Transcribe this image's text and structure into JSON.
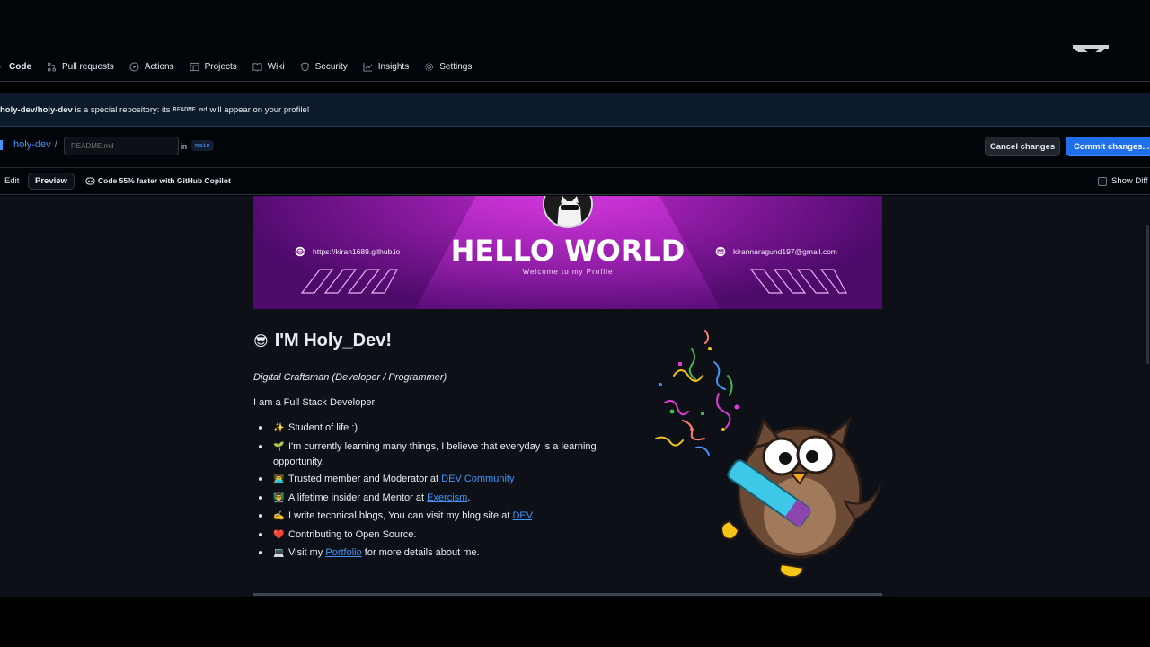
{
  "nav": {
    "items": [
      {
        "label": "Code",
        "icon": "chevron-icon"
      },
      {
        "label": "Pull requests",
        "icon": "pull-request-icon"
      },
      {
        "label": "Actions",
        "icon": "play-circle-icon"
      },
      {
        "label": "Projects",
        "icon": "table-icon"
      },
      {
        "label": "Wiki",
        "icon": "book-icon"
      },
      {
        "label": "Security",
        "icon": "shield-icon"
      },
      {
        "label": "Insights",
        "icon": "graph-icon"
      },
      {
        "label": "Settings",
        "icon": "gear-icon"
      }
    ]
  },
  "notice": {
    "repo": "holy-dev/holy-dev",
    "text1": "is a special repository: its",
    "file": "README.md",
    "text2": "will appear on your profile!"
  },
  "editor": {
    "repo_link": "holy-dev",
    "slash": "/",
    "filename_placeholder": "README.md",
    "in_label": "in",
    "branch": "main",
    "cancel_label": "Cancel changes",
    "commit_label": "Commit changes..."
  },
  "tabs": {
    "edit": "Edit",
    "preview": "Preview",
    "copilot": "Code 55% faster with GitHub Copilot",
    "show_diff": "Show Diff"
  },
  "banner": {
    "title": "HELLO WORLD",
    "subtitle": "Welcome to my Profile",
    "website": "https://kiran1689.github.io",
    "email": "kirannaragund197@gmail.com"
  },
  "readme": {
    "heading_emoji": "😎",
    "heading": "I'M Holy_Dev!",
    "subtitle": "Digital Craftsman (Developer / Programmer)",
    "intro": "I am a Full Stack Developer",
    "items": [
      {
        "emoji": "✨",
        "text": "Student of life :)"
      },
      {
        "emoji": "🌱",
        "text": "I'm currently learning many things, I believe that everyday is a learning opportunity."
      },
      {
        "emoji": "👨‍💻",
        "pre": "Trusted member and Moderator at ",
        "link": "DEV Community",
        "post": ""
      },
      {
        "emoji": "👨‍🏫",
        "pre": "A lifetime insider and Mentor at ",
        "link": "Exercism",
        "post": "."
      },
      {
        "emoji": "✍️",
        "pre": "I write technical blogs, You can visit my blog site at ",
        "link": "DEV",
        "post": "."
      },
      {
        "emoji": "❤️",
        "text": "Contributing to Open Source."
      },
      {
        "emoji": "💻",
        "pre": "Visit my ",
        "link": "Portfolio",
        "post": " for more details about me."
      }
    ]
  },
  "colors": {
    "accent": "#1f6feb",
    "link": "#4493f8",
    "background": "#0d1117",
    "banner": "#9a1fb0"
  }
}
